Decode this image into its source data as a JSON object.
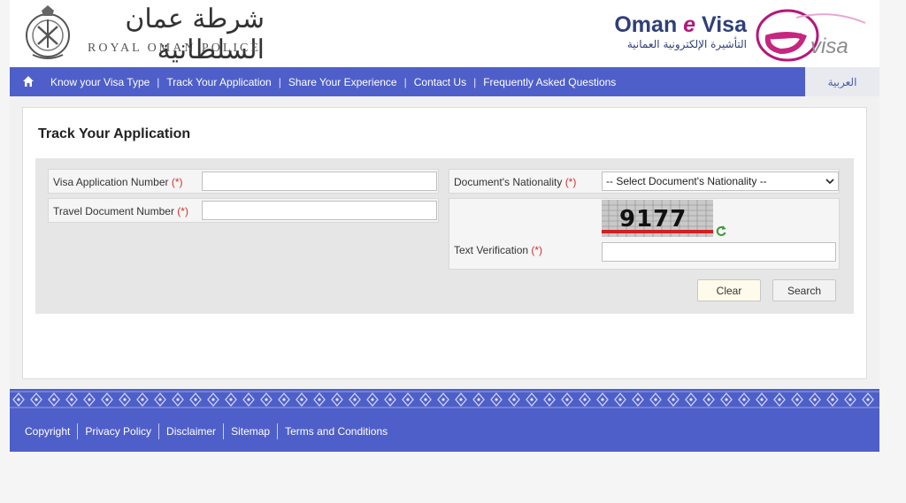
{
  "header": {
    "police_arabic": "شرطة عمان السلطانية",
    "police_english": "ROYAL OMAN POLICE",
    "evisa_title_prefix": "Oman ",
    "evisa_title_e": "e",
    "evisa_title_suffix": " Visa",
    "evisa_arabic": "التأشيرة الإلكترونية العمانية",
    "evisa_logo_text": "visa"
  },
  "nav": {
    "home_icon": "home-icon",
    "items": [
      {
        "label": "Know your Visa Type"
      },
      {
        "label": "Track Your Application"
      },
      {
        "label": "Share Your Experience"
      },
      {
        "label": "Contact Us"
      },
      {
        "label": "Frequently Asked Questions"
      }
    ],
    "separator": "|",
    "language": "العربية"
  },
  "main": {
    "title": "Track Your Application",
    "fields": {
      "visa_number_label": "Visa Application Number",
      "visa_number_value": "",
      "travel_doc_label": "Travel Document Number",
      "travel_doc_value": "",
      "nationality_label": "Document's Nationality",
      "nationality_selected": "-- Select Document's Nationality --",
      "verification_label": "Text Verification",
      "verification_value": "",
      "required_mark": "(*)",
      "captcha_text": "9177"
    },
    "buttons": {
      "clear": "Clear",
      "search": "Search"
    }
  },
  "footer": {
    "links": [
      "Copyright",
      "Privacy Policy",
      "Disclaimer",
      "Sitemap",
      "Terms and Conditions"
    ]
  },
  "colors": {
    "nav_bg": "#4f5fc9",
    "brand_navy": "#2f3f78",
    "brand_magenta": "#b3187a",
    "required": "#d23030"
  }
}
